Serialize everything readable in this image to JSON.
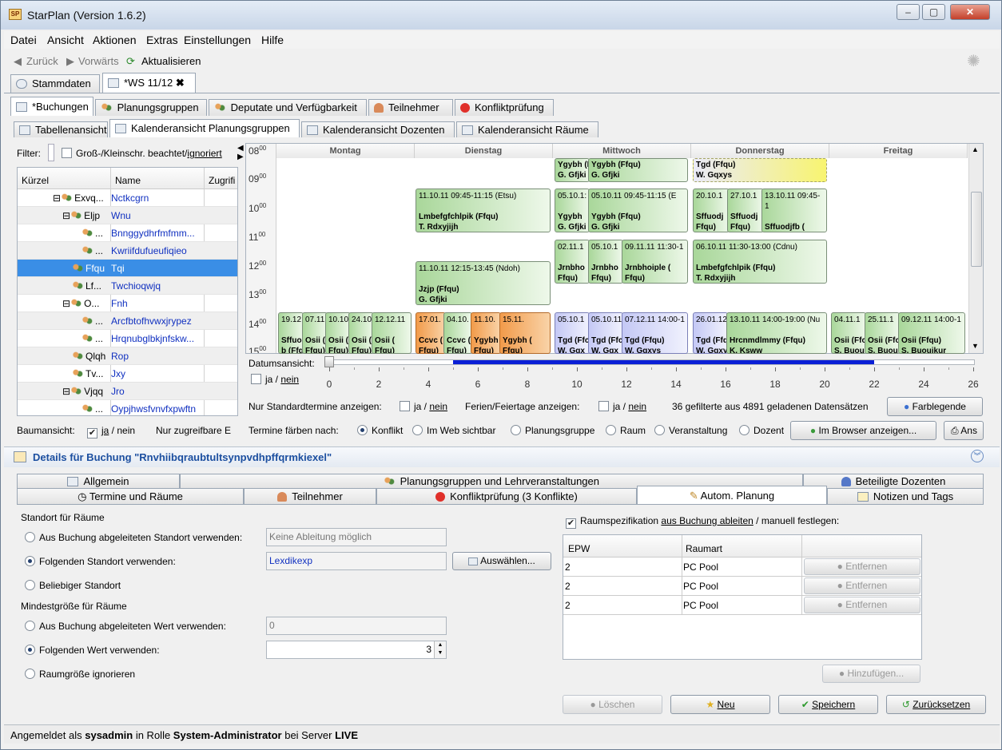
{
  "window": {
    "title": "StarPlan (Version 1.6.2)",
    "logo": "SP"
  },
  "menu": [
    "Datei",
    "Ansicht",
    "Aktionen",
    "Extras",
    "Einstellungen",
    "Hilfe"
  ],
  "toolbar": {
    "back": "Zurück",
    "forward": "Vorwärts",
    "refresh": "Aktualisieren"
  },
  "doc_tabs": [
    "Stammdaten",
    "*WS 11/12"
  ],
  "main_tabs": [
    "*Buchungen",
    "Planungsgruppen",
    "Deputate und Verfügbarkeit",
    "Teilnehmer",
    "Konfliktprüfung"
  ],
  "view_tabs": [
    "Tabellenansicht",
    "Kalenderansicht Planungsgruppen",
    "Kalenderansicht Dozenten",
    "Kalenderansicht Räume"
  ],
  "filter": {
    "label": "Filter:",
    "case_label": "Groß-/Kleinschr. beachtet/",
    "ignore_link": "ignoriert"
  },
  "tree": {
    "columns": [
      "Kürzel",
      "Name",
      "Zugrifi"
    ],
    "rows": [
      {
        "k": "Exvq...",
        "n": "Nctkcgrn"
      },
      {
        "k": "Eljp",
        "n": "Wnu"
      },
      {
        "k": "...",
        "n": "Bnnggydhrfmfmm..."
      },
      {
        "k": "...",
        "n": "Kwriifdufueufiqieo"
      },
      {
        "k": "Ffqu",
        "n": "Tqi"
      },
      {
        "k": "Lf...",
        "n": "Twchioqwjq"
      },
      {
        "k": "O...",
        "n": "Fnh"
      },
      {
        "k": "...",
        "n": "Arcfbtofhvwxjrypez"
      },
      {
        "k": "...",
        "n": "Hrqnubglbkjnfskw..."
      },
      {
        "k": "Qlqh",
        "n": "Rop"
      },
      {
        "k": "Tv...",
        "n": "Jxy"
      },
      {
        "k": "Vjqq",
        "n": "Jro"
      },
      {
        "k": "...",
        "n": "Oypjhwsfvnvfxpwftn"
      }
    ],
    "tree_view_label": "Baumansicht:",
    "tree_view_value": "ja",
    "tree_view_no": "nein",
    "only_accessible": "Nur zugreifbare E"
  },
  "calendar": {
    "days": [
      "Montag",
      "Dienstag",
      "Mittwoch",
      "Donnerstag",
      "Freitag"
    ],
    "hours": [
      "08",
      "09",
      "10",
      "11",
      "12",
      "13",
      "14",
      "15"
    ],
    "events": [
      {
        "t": "Ygybh (Ffqu)\nG. Gfjki"
      },
      {
        "t": "Ygybh (Ffqu)\nG. Gfjki"
      },
      {
        "t": "Tgd (Ffqu)\nW. Gqxys"
      },
      {
        "h": "11.10.11 09:45-11:15 (Etsu)",
        "t": "Lmbefgfchlpik (Ffqu)\nT. Rdxyjijh"
      },
      {
        "h": "05.10.1:",
        "t": "Ygybh\nG. Gfjki"
      },
      {
        "h": "05.10.11 09:45-11:15 (E",
        "t": "Ygybh (Ffqu)\nG. Gfjki"
      },
      {
        "h": "20.10.1",
        "t": "Sffuodj\nFfqu)"
      },
      {
        "h": "27.10.1",
        "t": "Sffuodj\nFfqu)"
      },
      {
        "h": "13.10.11 09:45-1",
        "t": "Sffuodjfb (\nFfqu)"
      },
      {
        "h": "02.11.1",
        "t": "Jrnbho\nFfqu)"
      },
      {
        "h": "05.10.1",
        "t": "Jrnbho\nFfqu)"
      },
      {
        "h": "09.11.11 11:30-1",
        "t": "Jrnbhoiple (\nFfqu)"
      },
      {
        "h": "06.10.11 11:30-13:00 (Cdnu)",
        "t": "Lmbefgfchlpik (Ffqu)\nT. Rdxyjijh"
      },
      {
        "h": "11.10.11 12:15-13:45 (Ndoh)",
        "t": "Jzjp (Ffqu)\nG. Gfjki"
      },
      {
        "h": "19.12",
        "t": "Sffuo\nb (Ffq"
      },
      {
        "h": "07.11",
        "t": "Osii (\nFfqu)"
      },
      {
        "h": "10.10",
        "t": "Osii (\nFfqu)"
      },
      {
        "h": "24.10",
        "t": "Osii (\nFfqu)"
      },
      {
        "h": "12.12.11",
        "t": "Osii (\nFfqu)"
      },
      {
        "h": "17.01.",
        "t": "Ccvc (\nFfqu)"
      },
      {
        "h": "04.10.",
        "t": "Ccvc (\nFfqu)"
      },
      {
        "h": "11.10.",
        "t": "Ygybh\nFfqu)"
      },
      {
        "h": "15.11.",
        "t": "Ygybh (\nFfqu)"
      },
      {
        "h": "05.10.1",
        "t": "Tgd (Ffc\nW. Gqx"
      },
      {
        "h": "05.10.11",
        "t": "Tgd (Ffc\nW. Gqx"
      },
      {
        "h": "07.12.11 14:00-1",
        "t": "Tgd (Ffqu)\nW. Gqxys"
      },
      {
        "h": "26.01.12",
        "t": "Tgd (Ffq\nW. Gqxy"
      },
      {
        "h": "13.10.11 14:00-19:00 (Nu",
        "t": "Hrcnmdlmmy (Ffqu)\nK. Ksww"
      },
      {
        "h": "04.11.1",
        "t": "Osii (Ffc\nS. Buou"
      },
      {
        "h": "25.11.1",
        "t": "Osii (Ffc\nS. Buou"
      },
      {
        "h": "09.12.11 14:00-1",
        "t": "Osii (Ffqu)\nS. Buoujkur"
      }
    ]
  },
  "date_view": {
    "label": "Datumsansicht:",
    "ticks": [
      "0",
      "2",
      "4",
      "6",
      "8",
      "10",
      "12",
      "14",
      "16",
      "18",
      "20",
      "22",
      "24",
      "26"
    ],
    "ja": "ja",
    "nein": "nein",
    "range_start": 5,
    "range_end": 22
  },
  "options": {
    "standard_label": "Nur Standardtermine anzeigen:",
    "holiday_label": "Ferien/Feiertage anzeigen:",
    "ja": "ja",
    "nein": "nein",
    "count_text": "36 gefilterte aus 4891 geladenen Datensätzen",
    "legend_btn": "Farblegende",
    "color_by_label": "Termine färben nach:",
    "color_by": [
      "Konflikt",
      "Im Web sichtbar",
      "Planungsgruppe",
      "Raum",
      "Veranstaltung",
      "Dozent"
    ],
    "browser_btn": "Im Browser anzeigen...",
    "print_btn": "Ans"
  },
  "details": {
    "title": "Details für Buchung \"Rnvhiibqraubtultsynpvdhpffqrmkiexel\"",
    "tabs_row1": [
      "Allgemein",
      "Planungsgruppen und Lehrveranstaltungen",
      "Beteiligte Dozenten"
    ],
    "tabs_row2": [
      "Termine und Räume",
      "Teilnehmer",
      "Konfliktprüfung (3 Konflikte)",
      "Autom. Planung",
      "Notizen und Tags"
    ],
    "location_section": "Standort für Räume",
    "loc_options": [
      "Aus Buchung abgeleiteten Standort verwenden:",
      "Folgenden Standort verwenden:",
      "Beliebiger Standort"
    ],
    "loc_derived_value": "Keine Ableitung möglich",
    "loc_value": "Lexdikexp",
    "select_btn": "Auswählen...",
    "size_section": "Mindestgröße für Räume",
    "size_options": [
      "Aus Buchung abgeleiteten Wert verwenden:",
      "Folgenden Wert verwenden:",
      "Raumgröße ignorieren"
    ],
    "size_derived_value": "0",
    "size_value": "3",
    "room_spec_pre": "Raumspezifikation ",
    "room_spec_link": "aus Buchung ableiten",
    "room_spec_post": " / manuell festlegen:",
    "table_cols": [
      "EPW",
      "Raumart",
      ""
    ],
    "table_rows": [
      {
        "epw": "2",
        "type": "PC Pool",
        "btn": "Entfernen"
      },
      {
        "epw": "2",
        "type": "PC Pool",
        "btn": "Entfernen"
      },
      {
        "epw": "2",
        "type": "PC Pool",
        "btn": "Entfernen"
      }
    ],
    "add_btn": "Hinzufügen...",
    "actions": [
      "Löschen",
      "Neu",
      "Speichern",
      "Zurücksetzen"
    ]
  },
  "status": {
    "pre": "Angemeldet als ",
    "user": "sysadmin",
    "mid": " in Rolle ",
    "role": "System-Administrator",
    "mid2": " bei Server ",
    "server": "LIVE"
  }
}
